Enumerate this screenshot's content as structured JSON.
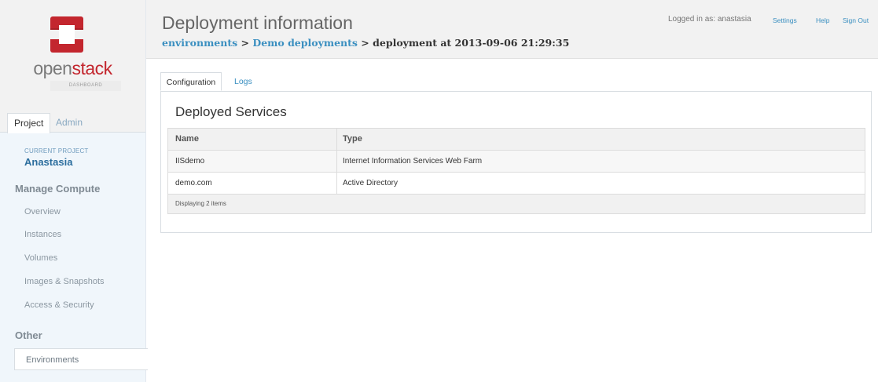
{
  "brand": {
    "name_part1": "open",
    "name_part2": "stack",
    "subtitle": "DASHBOARD",
    "accent_color": "#c3262e",
    "logo_icon": "openstack-logo-icon"
  },
  "sidebar": {
    "tabs": [
      {
        "label": "Project",
        "active": true
      },
      {
        "label": "Admin",
        "active": false
      }
    ],
    "current_project_label": "CURRENT PROJECT",
    "current_project_name": "Anastasia",
    "sections": [
      {
        "heading": "Manage Compute",
        "items": [
          "Overview",
          "Instances",
          "Volumes",
          "Images & Snapshots",
          "Access & Security"
        ]
      },
      {
        "heading": "Other",
        "items": [
          "Environments"
        ]
      }
    ],
    "active_item": "Environments"
  },
  "header": {
    "title": "Deployment information",
    "breadcrumb": {
      "link1": "environments",
      "link2": "Demo deployments",
      "current": "deployment at 2013-09-06 21:29:35",
      "separator": ">"
    },
    "logged_in_text": "Logged in as: anastasia",
    "settings_label": "Settings",
    "help_label": "Help",
    "signout_label": "Sign Out"
  },
  "content": {
    "tabs": [
      {
        "label": "Configuration",
        "active": true
      },
      {
        "label": "Logs",
        "active": false
      }
    ],
    "panel_title": "Deployed Services",
    "table": {
      "columns": [
        "Name",
        "Type"
      ],
      "rows": [
        [
          "IISdemo",
          "Internet Information Services Web Farm"
        ],
        [
          "demo.com",
          "Active Directory"
        ]
      ],
      "footer": "Displaying 2 items"
    }
  },
  "colors": {
    "link": "#3a8fc0",
    "sidebar_bg": "#f0f6fb",
    "header_bg": "#f2f2f2"
  }
}
